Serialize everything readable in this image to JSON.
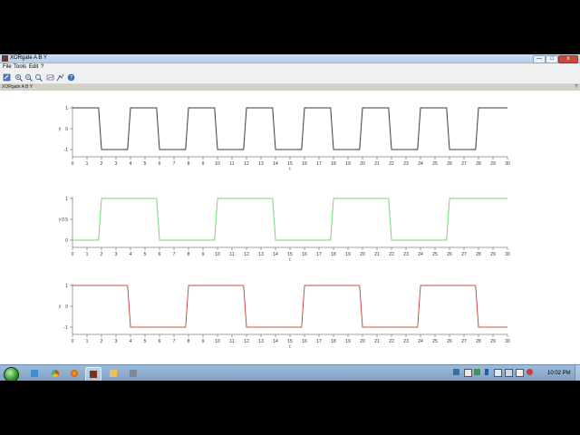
{
  "window": {
    "title": "XORgate A B Y",
    "min_label": "—",
    "max_label": "□",
    "close_label": "x"
  },
  "menubar": {
    "items": [
      "File",
      "Tools",
      "Edit",
      "?"
    ]
  },
  "toolbar": {
    "icons": [
      "rotate-icon",
      "zoom-in-icon",
      "zoom-out-icon",
      "zoom-fit-icon",
      "datatip-icon",
      "graphic-edit-icon",
      "help-icon"
    ]
  },
  "figure": {
    "title": "XORgate A B Y",
    "help": "?"
  },
  "chart_data": [
    {
      "type": "line",
      "x_ticks": [
        0,
        1,
        2,
        3,
        4,
        5,
        6,
        7,
        8,
        9,
        10,
        11,
        12,
        13,
        14,
        15,
        16,
        17,
        18,
        19,
        20,
        21,
        22,
        23,
        24,
        25,
        26,
        27,
        28,
        29,
        30
      ],
      "y_ticks": [
        "1",
        "0",
        "-1"
      ],
      "ylabel": "y",
      "xlabel": "t",
      "xlim": [
        0,
        30
      ],
      "ylim": [
        -1,
        1
      ],
      "series": [
        {
          "color": "#3a3a3a",
          "x": [
            0,
            1.8,
            2,
            3.8,
            4,
            5.8,
            6,
            7.8,
            8,
            9.8,
            10,
            11.8,
            12,
            13.8,
            14,
            15.8,
            16,
            17.8,
            18,
            19.8,
            20,
            21.8,
            22,
            23.8,
            24,
            25.8,
            26,
            27.8,
            28,
            30
          ],
          "y": [
            1,
            1,
            -1,
            -1,
            1,
            1,
            -1,
            -1,
            1,
            1,
            -1,
            -1,
            1,
            1,
            -1,
            -1,
            1,
            1,
            -1,
            -1,
            1,
            1,
            -1,
            -1,
            1,
            1,
            -1,
            -1,
            1,
            1
          ]
        }
      ]
    },
    {
      "type": "line",
      "x_ticks": [
        0,
        1,
        2,
        3,
        4,
        5,
        6,
        7,
        8,
        9,
        10,
        11,
        12,
        13,
        14,
        15,
        16,
        17,
        18,
        19,
        20,
        21,
        22,
        23,
        24,
        25,
        26,
        27,
        28,
        29,
        30
      ],
      "y_ticks": [
        "1",
        "0.5",
        "0"
      ],
      "ylabel": "y",
      "xlabel": "t",
      "xlim": [
        0,
        30
      ],
      "ylim": [
        0,
        1
      ],
      "series": [
        {
          "color": "#7cd67c",
          "x": [
            0,
            1.8,
            2,
            5.8,
            6,
            9.8,
            10,
            13.8,
            14,
            17.8,
            18,
            21.8,
            22,
            25.8,
            26,
            30
          ],
          "y": [
            0,
            0,
            1,
            1,
            0,
            0,
            1,
            1,
            0,
            0,
            1,
            1,
            0,
            0,
            1,
            1
          ]
        }
      ]
    },
    {
      "type": "line",
      "x_ticks": [
        0,
        1,
        2,
        3,
        4,
        5,
        6,
        7,
        8,
        9,
        10,
        11,
        12,
        13,
        14,
        15,
        16,
        17,
        18,
        19,
        20,
        21,
        22,
        23,
        24,
        25,
        26,
        27,
        28,
        29,
        30
      ],
      "y_ticks": [
        "1",
        "0",
        "-1"
      ],
      "ylabel": "y",
      "xlabel": "t",
      "xlim": [
        0,
        30
      ],
      "ylim": [
        -1,
        1
      ],
      "series": [
        {
          "color": "#c0504d",
          "x": [
            0,
            3.8,
            4,
            7.8,
            8,
            11.8,
            12,
            15.8,
            16,
            19.8,
            20,
            23.8,
            24,
            27.8,
            28,
            30
          ],
          "y": [
            1,
            1,
            -1,
            -1,
            1,
            1,
            -1,
            -1,
            1,
            1,
            -1,
            -1,
            1,
            1,
            -1,
            -1
          ]
        }
      ]
    }
  ],
  "taskbar": {
    "apps": [
      "windows-explorer-icon",
      "chrome-icon",
      "firefox-icon",
      "scilab-icon",
      "folder-icon",
      "network-icon"
    ],
    "tray": [
      "flag-icon",
      "battery-icon",
      "q-icon",
      "bluetooth-icon",
      "network-tray-icon",
      "monitor-icon",
      "volume-icon",
      "power-icon"
    ],
    "clock": "10:02 PM"
  }
}
